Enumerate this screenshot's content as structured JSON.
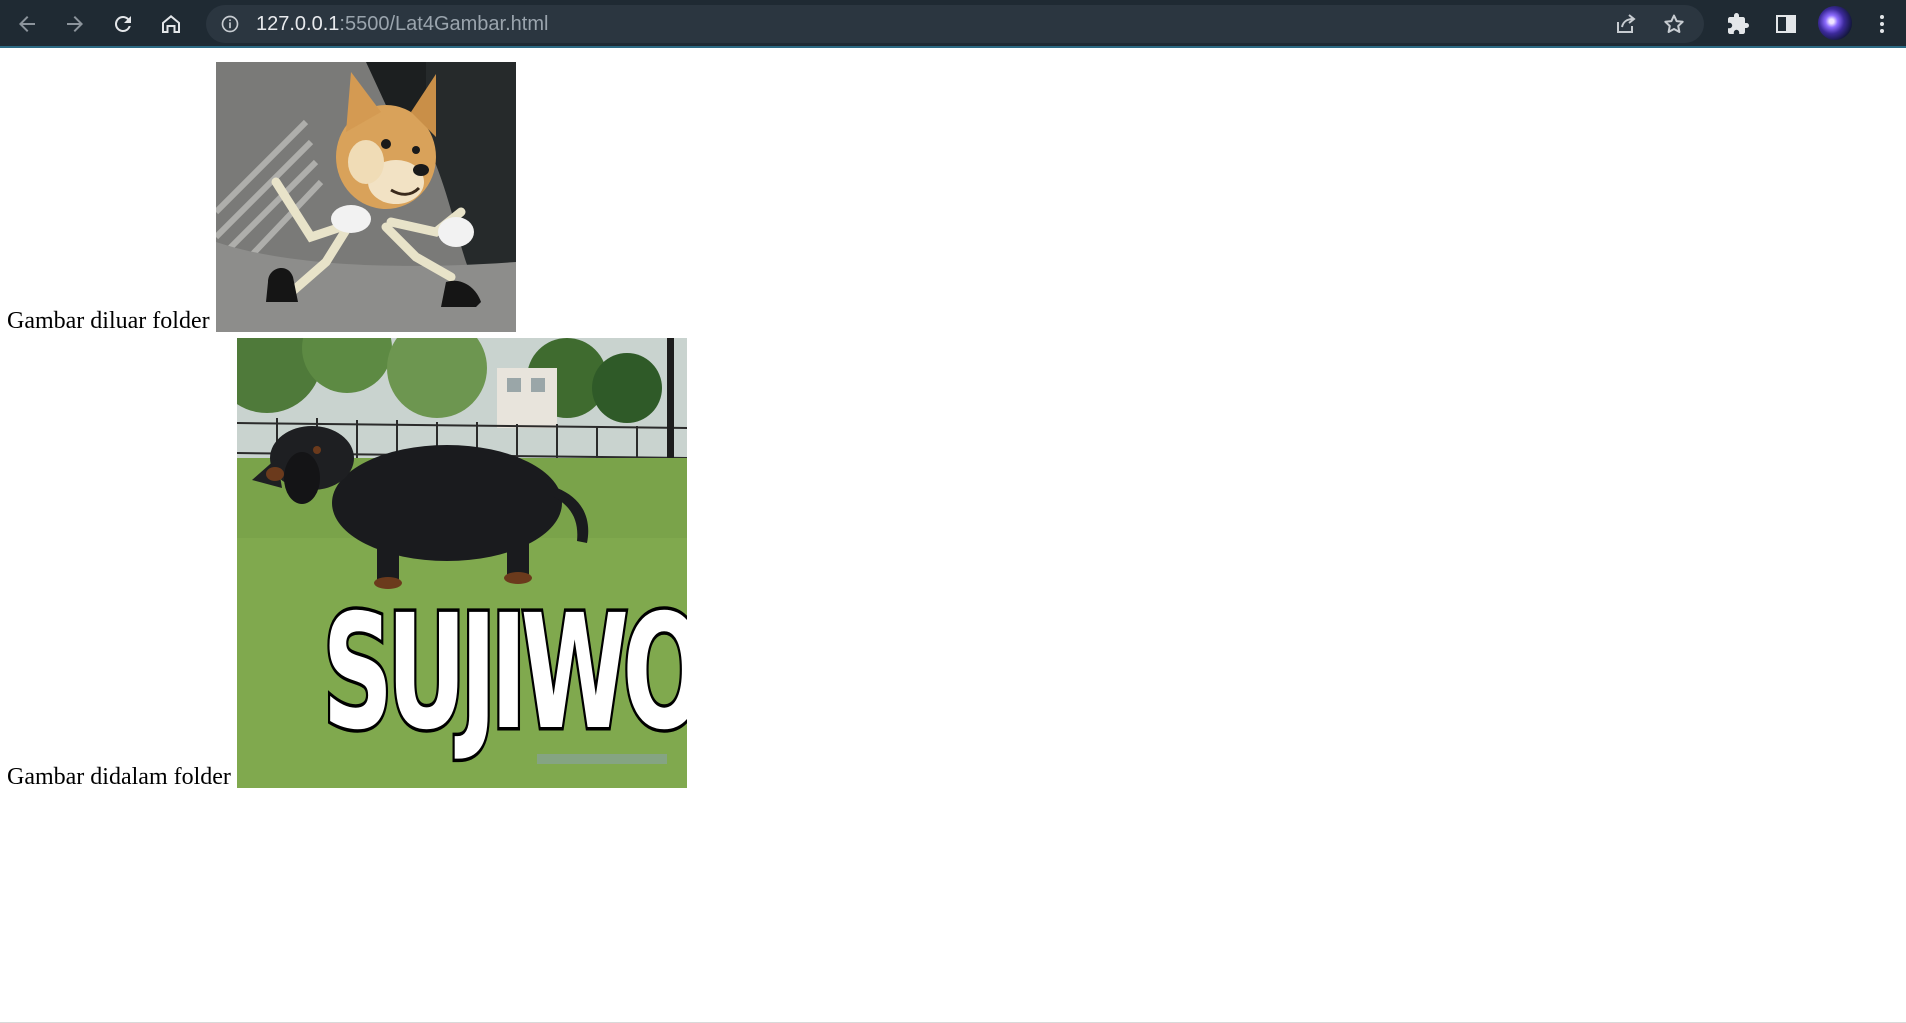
{
  "browser": {
    "url_host": "127.0.0.1",
    "url_rest": ":5500/Lat4Gambar.html",
    "icons": {
      "back": "arrow-left-icon",
      "forward": "arrow-right-icon",
      "reload": "reload-icon",
      "home": "home-icon",
      "site_info": "info-icon",
      "share": "share-icon",
      "bookmark": "star-icon",
      "extensions": "puzzle-icon",
      "side_panel": "side-panel-icon",
      "profile": "avatar",
      "menu": "kebab-menu-icon"
    },
    "colors": {
      "toolbar_bg": "#1f2a33",
      "omnibox_bg": "#2b3640",
      "accent_border": "#2c6a84"
    }
  },
  "page": {
    "images": [
      {
        "caption": "Gambar diluar folder",
        "subject": "shiba inu doge with skeleton arms and legs"
      },
      {
        "caption": "Gambar didalam folder",
        "subject": "black dachshund on grass",
        "overlay_text": "SUJIWO"
      }
    ]
  }
}
